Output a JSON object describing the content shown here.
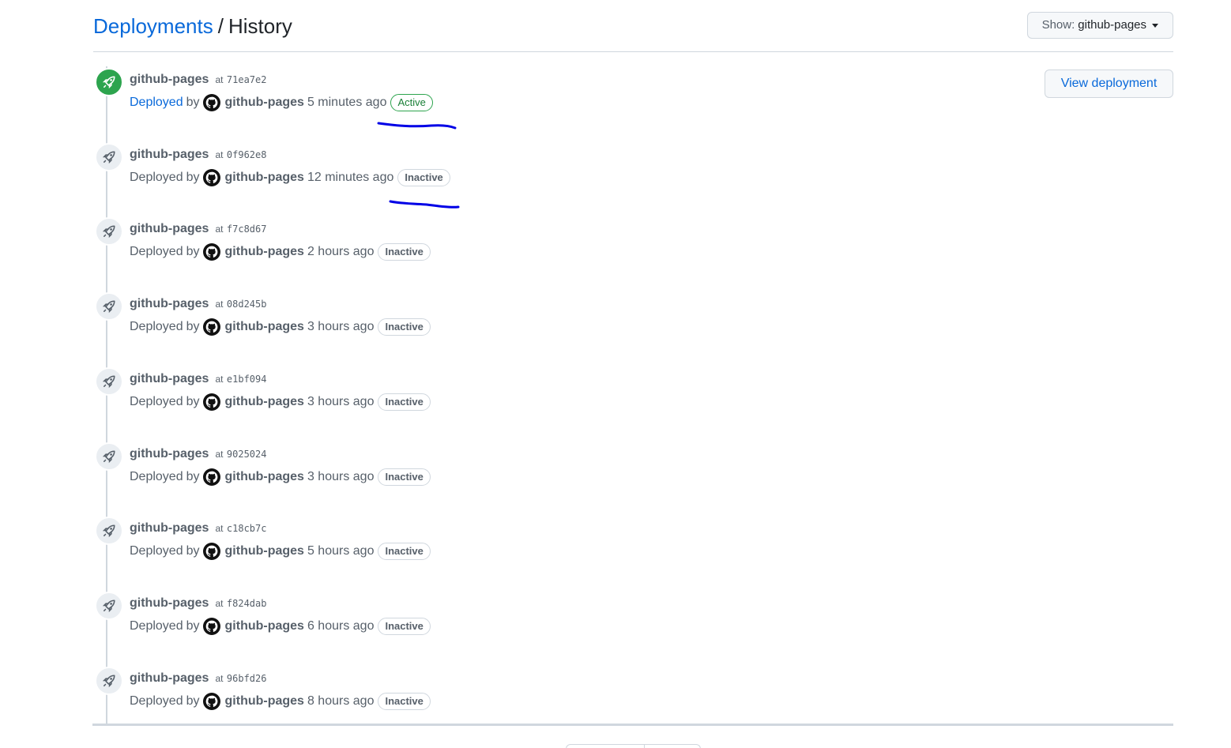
{
  "breadcrumb": {
    "parent": "Deployments",
    "separator": "/",
    "current": "History"
  },
  "filter": {
    "prefix": "Show:",
    "value": "github-pages"
  },
  "view_deployment_label": "View deployment",
  "deployments": [
    {
      "environment": "github-pages",
      "at": "at",
      "sha": "71ea7e2",
      "deployed": "Deployed",
      "by": "by",
      "actor": "github-pages",
      "time": "5 minutes ago",
      "status": "Active"
    },
    {
      "environment": "github-pages",
      "at": "at",
      "sha": "0f962e8",
      "deployed": "Deployed",
      "by": "by",
      "actor": "github-pages",
      "time": "12 minutes ago",
      "status": "Inactive"
    },
    {
      "environment": "github-pages",
      "at": "at",
      "sha": "f7c8d67",
      "deployed": "Deployed",
      "by": "by",
      "actor": "github-pages",
      "time": "2 hours ago",
      "status": "Inactive"
    },
    {
      "environment": "github-pages",
      "at": "at",
      "sha": "08d245b",
      "deployed": "Deployed",
      "by": "by",
      "actor": "github-pages",
      "time": "3 hours ago",
      "status": "Inactive"
    },
    {
      "environment": "github-pages",
      "at": "at",
      "sha": "e1bf094",
      "deployed": "Deployed",
      "by": "by",
      "actor": "github-pages",
      "time": "3 hours ago",
      "status": "Inactive"
    },
    {
      "environment": "github-pages",
      "at": "at",
      "sha": "9025024",
      "deployed": "Deployed",
      "by": "by",
      "actor": "github-pages",
      "time": "3 hours ago",
      "status": "Inactive"
    },
    {
      "environment": "github-pages",
      "at": "at",
      "sha": "c18cb7c",
      "deployed": "Deployed",
      "by": "by",
      "actor": "github-pages",
      "time": "5 hours ago",
      "status": "Inactive"
    },
    {
      "environment": "github-pages",
      "at": "at",
      "sha": "f824dab",
      "deployed": "Deployed",
      "by": "by",
      "actor": "github-pages",
      "time": "6 hours ago",
      "status": "Inactive"
    },
    {
      "environment": "github-pages",
      "at": "at",
      "sha": "96bfd26",
      "deployed": "Deployed",
      "by": "by",
      "actor": "github-pages",
      "time": "8 hours ago",
      "status": "Inactive"
    }
  ],
  "icons": {
    "rocket": "rocket-icon",
    "avatar": "github-octocat-icon",
    "caret": "caret-down-icon"
  },
  "colors": {
    "link": "#0969da",
    "active_green": "#2da44e",
    "annotation_blue": "#0000e6"
  }
}
